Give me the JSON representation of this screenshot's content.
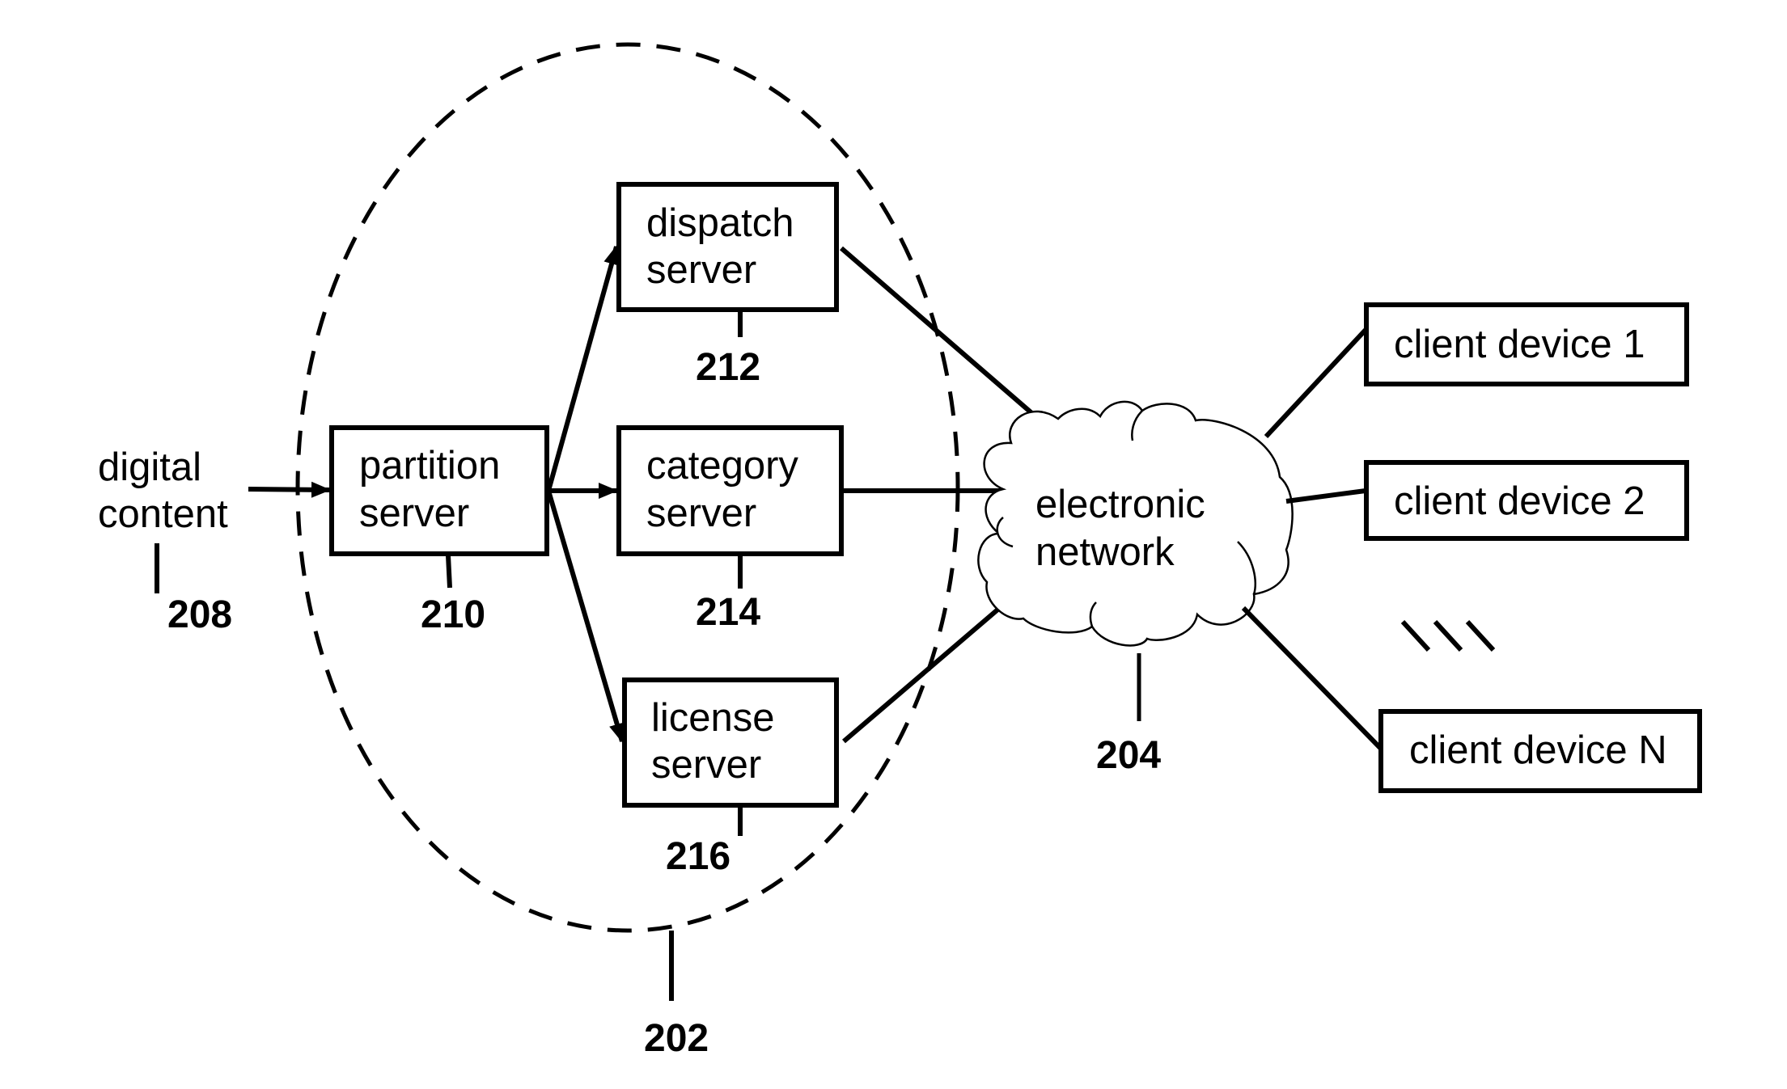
{
  "diagram": {
    "input": {
      "line1": "digital",
      "line2": "content",
      "ref": "208"
    },
    "group": {
      "ref": "202"
    },
    "partition": {
      "line1": "partition",
      "line2": "server",
      "ref": "210"
    },
    "dispatch": {
      "line1": "dispatch",
      "line2": "server",
      "ref": "212"
    },
    "category": {
      "line1": "category",
      "line2": "server",
      "ref": "214"
    },
    "license": {
      "line1": "license",
      "line2": "server",
      "ref": "216"
    },
    "network": {
      "line1": "electronic",
      "line2": "network",
      "ref": "204"
    },
    "clients": [
      {
        "label": "client device 1"
      },
      {
        "label": "client device 2"
      },
      {
        "label": "client device N"
      }
    ],
    "ellipsis_icon": "triple-slash-ellipsis"
  }
}
